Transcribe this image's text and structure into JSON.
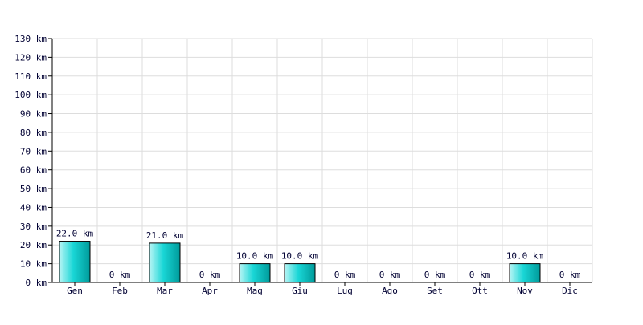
{
  "chart_data": {
    "type": "bar",
    "categories": [
      "Gen",
      "Feb",
      "Mar",
      "Apr",
      "Mag",
      "Giu",
      "Lug",
      "Ago",
      "Set",
      "Ott",
      "Nov",
      "Dic"
    ],
    "values": [
      22.0,
      0,
      21.0,
      0,
      10.0,
      10.0,
      0,
      0,
      0,
      0,
      10.0,
      0
    ],
    "data_labels": [
      "22.0 km",
      "0 km",
      "21.0 km",
      "0 km",
      "10.0 km",
      "10.0 km",
      "0 km",
      "0 km",
      "0 km",
      "0 km",
      "10.0 km",
      "0 km"
    ],
    "unit": "km",
    "ylim": [
      0,
      130
    ],
    "ytick_step": 10,
    "grid": true,
    "title": "",
    "xlabel": "",
    "ylabel": "",
    "colors": {
      "bar_light": "#b8f5f5",
      "bar_mid": "#19d6d6",
      "bar_dark": "#009a9a",
      "bar_stroke": "#000000",
      "grid": "#dddddd",
      "axis": "#000000",
      "text": "#000033"
    }
  }
}
